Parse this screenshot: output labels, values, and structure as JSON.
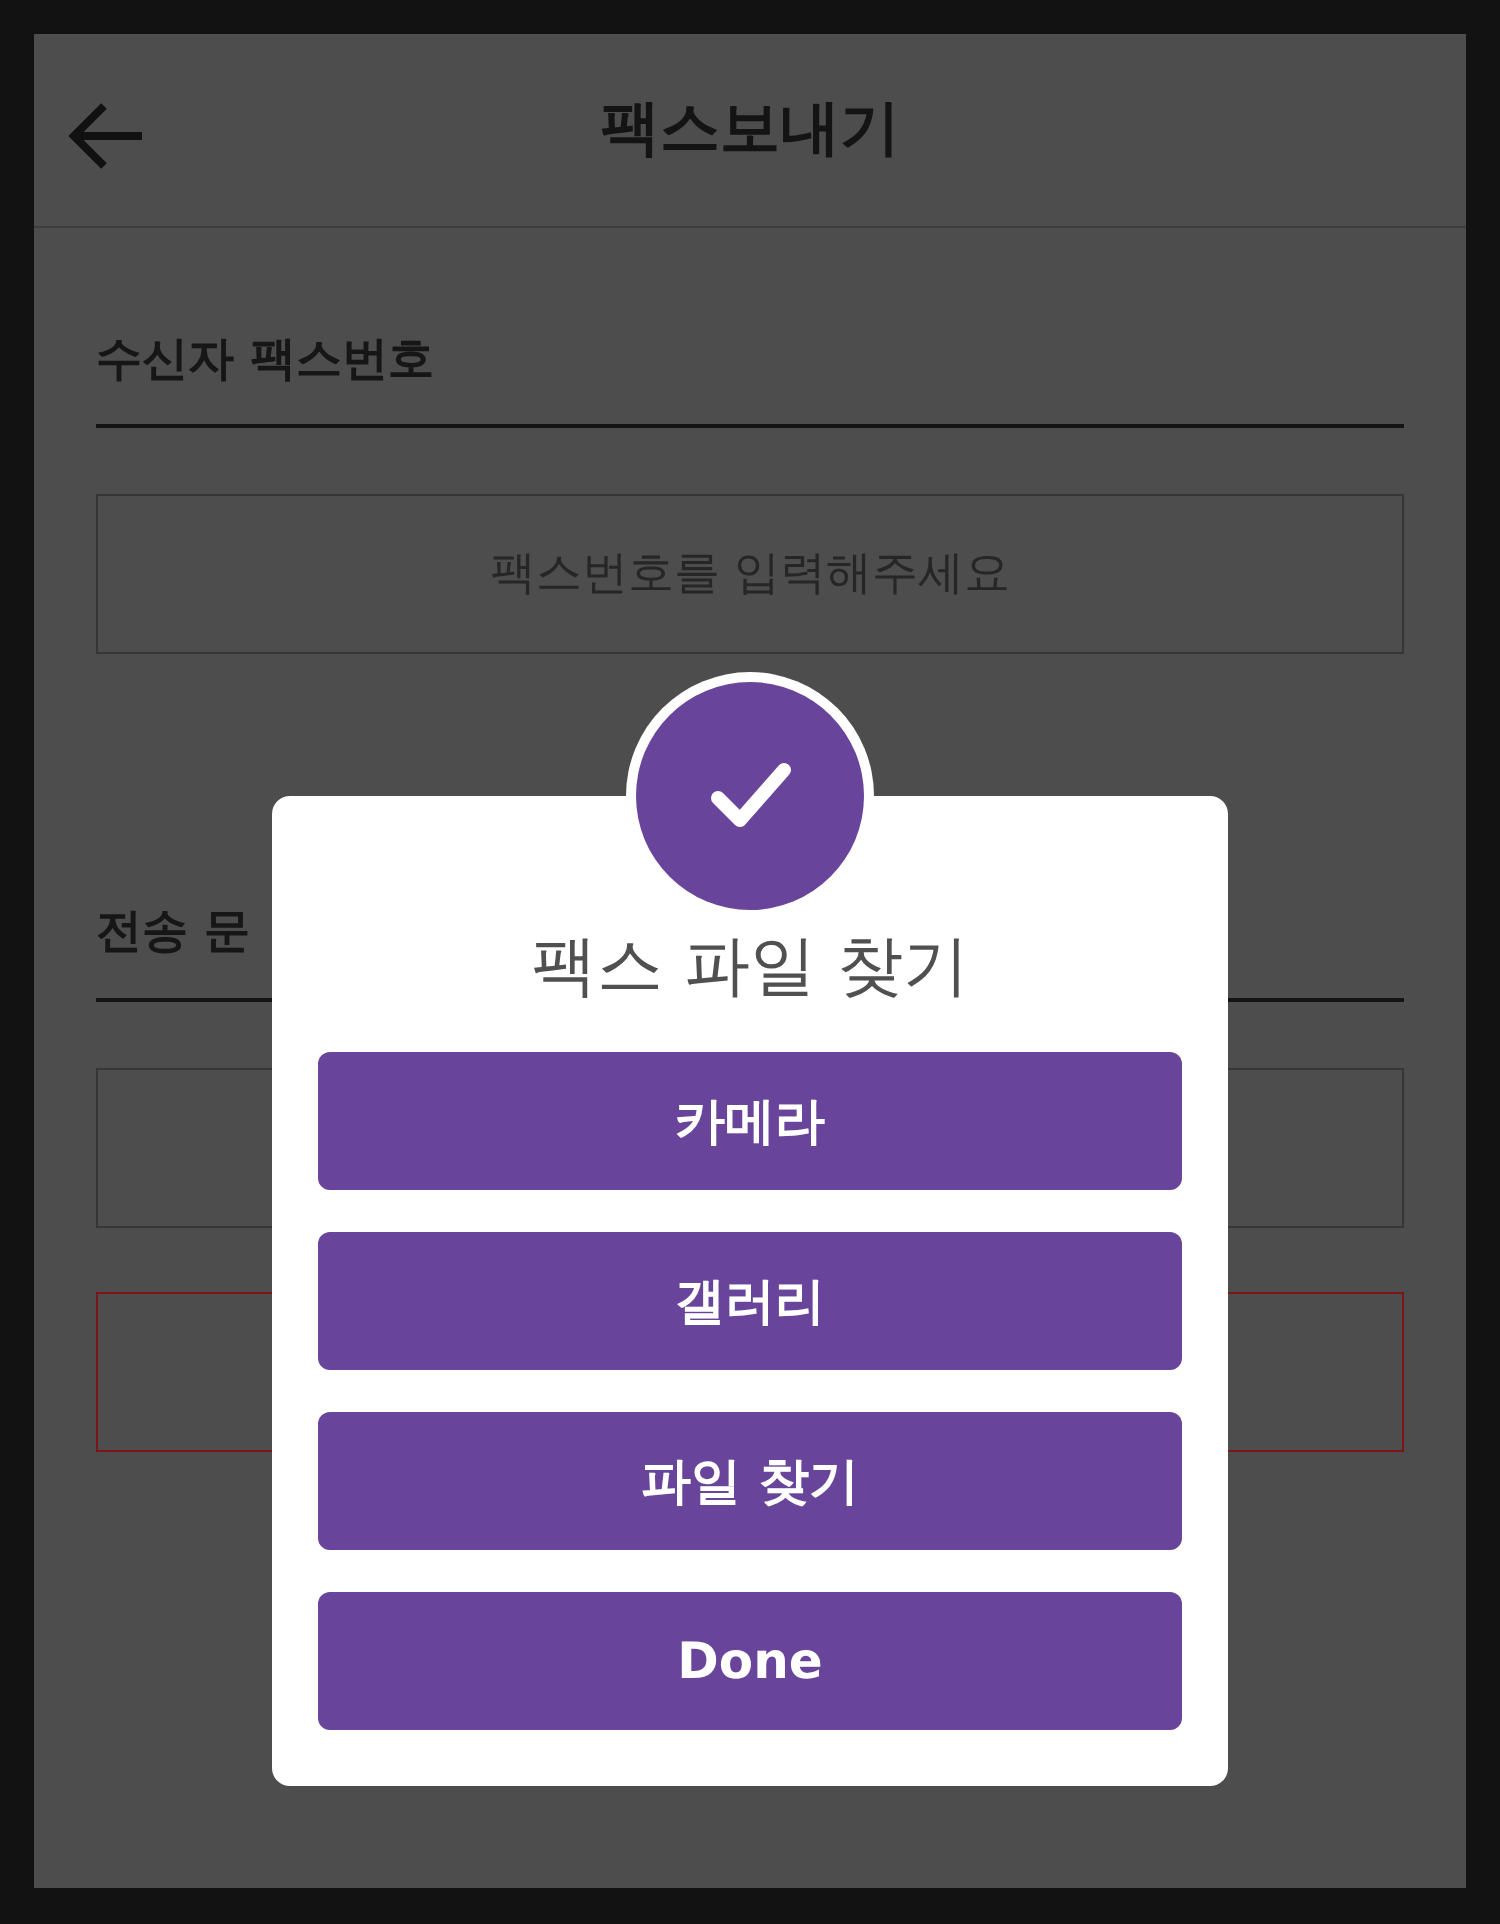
{
  "header": {
    "title": "팩스보내기"
  },
  "recipient": {
    "label": "수신자 팩스번호",
    "field": {
      "placeholder": "팩스번호를 입력해주세요"
    }
  },
  "document": {
    "label": "전송 문",
    "boxes": [
      {
        "highlighted": false
      },
      {
        "highlighted": true
      }
    ]
  },
  "dialog": {
    "title": "팩스 파일 찾기",
    "buttons": [
      {
        "label": "카메라"
      },
      {
        "label": "갤러리"
      },
      {
        "label": "파일 찾기"
      },
      {
        "label": "Done"
      }
    ]
  }
}
